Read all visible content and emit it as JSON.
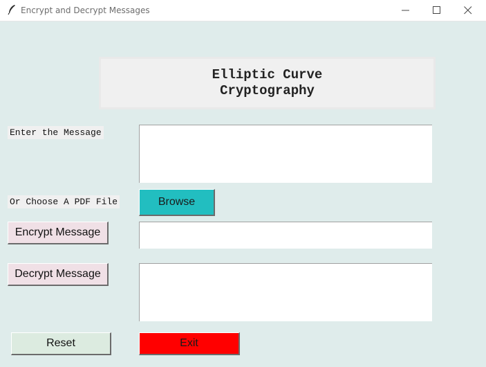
{
  "window": {
    "title": "Encrypt and Decrypt Messages",
    "app_icon": "feather-icon",
    "controls": [
      "minimize-icon",
      "maximize-icon",
      "close-icon"
    ]
  },
  "heading": {
    "line1": "Elliptic Curve",
    "line2": "Cryptography"
  },
  "message_label": "Enter the Message",
  "message_value": "",
  "pdf_label": "Or Choose A PDF File",
  "browse_label": "Browse",
  "encrypt_label": "Encrypt Message",
  "encrypted_value": "",
  "decrypt_label": "Decrypt Message",
  "decrypted_value": "",
  "reset_label": "Reset",
  "exit_label": "Exit",
  "colors": {
    "background": "#dfeceb",
    "browse": "#22bec0",
    "encrypt_decrypt": "#f0e0e6",
    "reset": "#dcebe0",
    "exit": "#ff0000"
  }
}
